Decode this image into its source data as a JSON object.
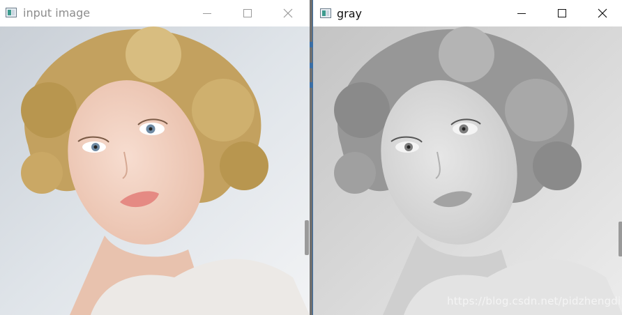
{
  "windows": [
    {
      "id": "input",
      "title": "input image",
      "icon": "app-window-icon",
      "controls": [
        "minimize-icon",
        "maximize-icon",
        "close-icon"
      ],
      "image": "color portrait of a young woman with curly blonde hair"
    },
    {
      "id": "gray",
      "title": "gray",
      "icon": "app-window-icon",
      "controls": [
        "minimize-icon",
        "maximize-icon",
        "close-icon"
      ],
      "image": "grayscale version of the same portrait",
      "watermark": "https://blog.csdn.net/pidzhengding"
    }
  ],
  "colors": {
    "background_input": "#d7dde3",
    "hair_input": "#c6a566",
    "skin_input": "#f1d0c2",
    "background_gray": "#cfcfcf",
    "hair_gray": "#9a9a9a",
    "skin_gray": "#d9d9d9"
  }
}
